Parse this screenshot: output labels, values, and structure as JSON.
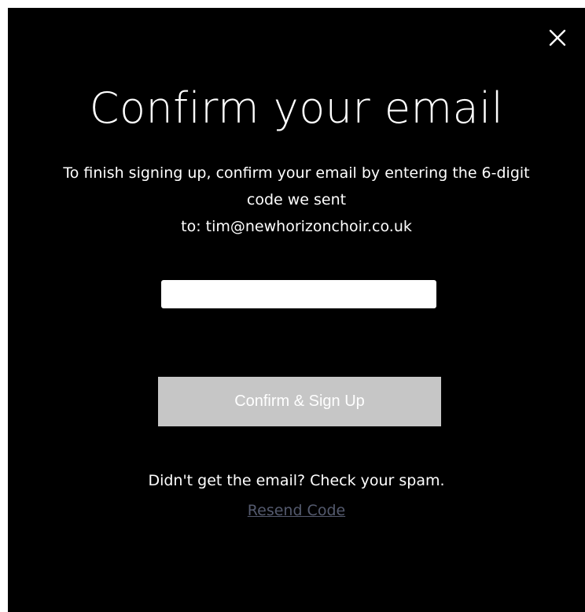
{
  "dialog": {
    "title": "Confirm your email",
    "message": {
      "line1": "To finish signing up, confirm your email by entering the 6-digit",
      "line2": "code we sent",
      "line3": "to: tim@newhorizonchoir.co.uk"
    },
    "code_input": {
      "value": "",
      "placeholder": ""
    },
    "submit_label": "Confirm & Sign Up",
    "spam_note": "Didn't get the email? Check your spam.",
    "resend_label": "Resend Code"
  },
  "icons": {
    "close": "close-icon"
  },
  "colors": {
    "background": "#000000",
    "text": "#ffffff",
    "button_disabled": "#c6c6c6",
    "link": "#545a6e"
  }
}
